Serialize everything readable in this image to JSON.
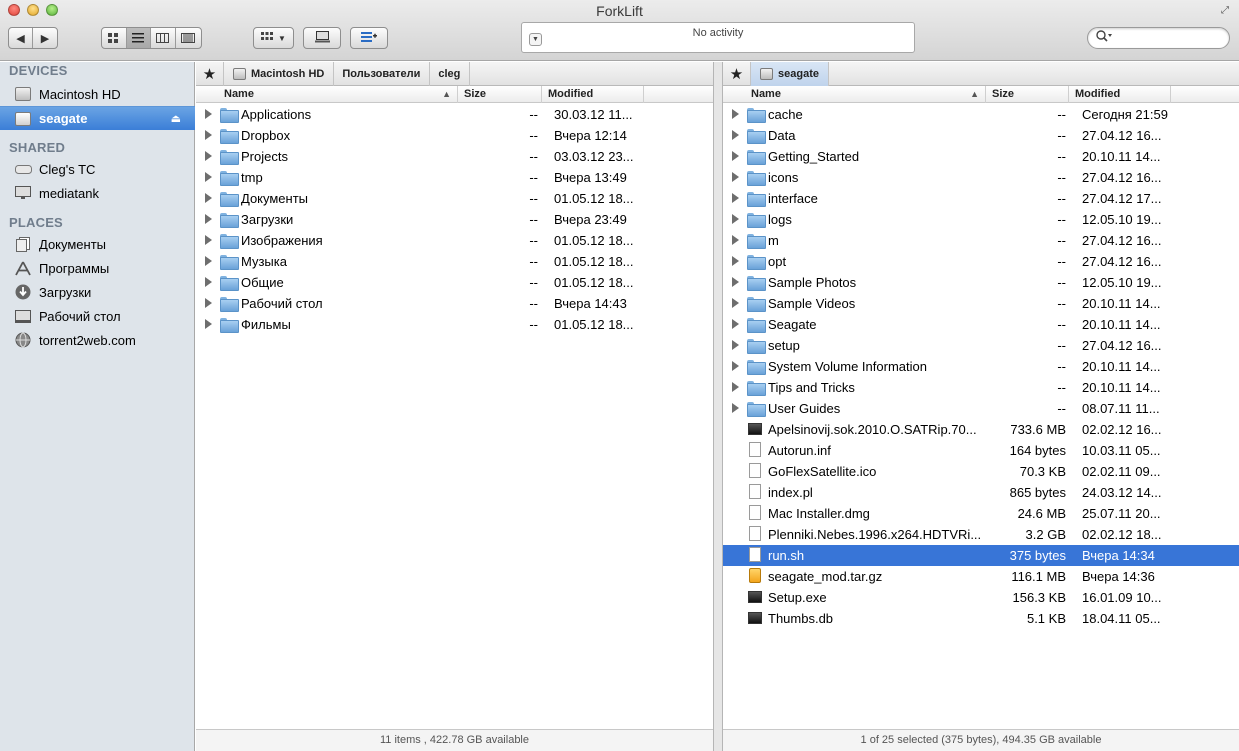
{
  "window": {
    "title": "ForkLift",
    "activity_text": "No activity"
  },
  "sidebar": {
    "sections": [
      {
        "heading": "DEVICES",
        "items": [
          {
            "label": "Macintosh HD",
            "icon": "hard-drive-icon"
          },
          {
            "label": "seagate",
            "icon": "external-drive-icon",
            "selected": true
          }
        ]
      },
      {
        "heading": "SHARED",
        "items": [
          {
            "label": "Cleg's TC",
            "icon": "network-drive-icon"
          },
          {
            "label": "mediatank",
            "icon": "monitor-icon"
          }
        ]
      },
      {
        "heading": "PLACES",
        "items": [
          {
            "label": "Документы",
            "icon": "documents-icon"
          },
          {
            "label": "Программы",
            "icon": "applications-icon"
          },
          {
            "label": "Загрузки",
            "icon": "downloads-icon"
          },
          {
            "label": "Рабочий стол",
            "icon": "desktop-icon"
          },
          {
            "label": "torrent2web.com",
            "icon": "globe-icon"
          }
        ]
      }
    ]
  },
  "left_pane": {
    "path": [
      "Macintosh HD",
      "Пользователи",
      "cleg"
    ],
    "columns": {
      "name": "Name",
      "size": "Size",
      "modified": "Modified"
    },
    "rows": [
      {
        "name": "Applications",
        "size": "--",
        "modified": "30.03.12 11..."
      },
      {
        "name": "Dropbox",
        "size": "--",
        "modified": "Вчера 12:14"
      },
      {
        "name": "Projects",
        "size": "--",
        "modified": "03.03.12 23..."
      },
      {
        "name": "tmp",
        "size": "--",
        "modified": "Вчера 13:49"
      },
      {
        "name": "Документы",
        "size": "--",
        "modified": "01.05.12 18..."
      },
      {
        "name": "Загрузки",
        "size": "--",
        "modified": "Вчера 23:49"
      },
      {
        "name": "Изображения",
        "size": "--",
        "modified": "01.05.12 18..."
      },
      {
        "name": "Музыка",
        "size": "--",
        "modified": "01.05.12 18..."
      },
      {
        "name": "Общие",
        "size": "--",
        "modified": "01.05.12 18..."
      },
      {
        "name": "Рабочий стол",
        "size": "--",
        "modified": "Вчера 14:43"
      },
      {
        "name": "Фильмы",
        "size": "--",
        "modified": "01.05.12 18..."
      }
    ],
    "status": "11 items , 422.78 GB available"
  },
  "right_pane": {
    "path": [
      "seagate"
    ],
    "columns": {
      "name": "Name",
      "size": "Size",
      "modified": "Modified"
    },
    "rows": [
      {
        "name": "cache",
        "size": "--",
        "modified": "Сегодня 21:59",
        "kind": "folder"
      },
      {
        "name": "Data",
        "size": "--",
        "modified": "27.04.12 16...",
        "kind": "folder"
      },
      {
        "name": "Getting_Started",
        "size": "--",
        "modified": "20.10.11 14...",
        "kind": "folder"
      },
      {
        "name": "icons",
        "size": "--",
        "modified": "27.04.12 16...",
        "kind": "folder"
      },
      {
        "name": "interface",
        "size": "--",
        "modified": "27.04.12 17...",
        "kind": "folder"
      },
      {
        "name": "logs",
        "size": "--",
        "modified": "12.05.10 19...",
        "kind": "folder"
      },
      {
        "name": "m",
        "size": "--",
        "modified": "27.04.12 16...",
        "kind": "folder"
      },
      {
        "name": "opt",
        "size": "--",
        "modified": "27.04.12 16...",
        "kind": "folder"
      },
      {
        "name": "Sample Photos",
        "size": "--",
        "modified": "12.05.10 19...",
        "kind": "folder"
      },
      {
        "name": "Sample Videos",
        "size": "--",
        "modified": "20.10.11 14...",
        "kind": "folder"
      },
      {
        "name": "Seagate",
        "size": "--",
        "modified": "20.10.11 14...",
        "kind": "folder"
      },
      {
        "name": "setup",
        "size": "--",
        "modified": "27.04.12 16...",
        "kind": "folder"
      },
      {
        "name": "System Volume Information",
        "size": "--",
        "modified": "20.10.11 14...",
        "kind": "folder"
      },
      {
        "name": "Tips and Tricks",
        "size": "--",
        "modified": "20.10.11 14...",
        "kind": "folder"
      },
      {
        "name": "User Guides",
        "size": "--",
        "modified": "08.07.11 11...",
        "kind": "folder"
      },
      {
        "name": "Apelsinovij.sok.2010.O.SATRip.70...",
        "size": "733.6 MB",
        "modified": "02.02.12 16...",
        "kind": "video"
      },
      {
        "name": "Autorun.inf",
        "size": "164 bytes",
        "modified": "10.03.11 05...",
        "kind": "doc"
      },
      {
        "name": "GoFlexSatellite.ico",
        "size": "70.3 KB",
        "modified": "02.02.11 09...",
        "kind": "doc"
      },
      {
        "name": "index.pl",
        "size": "865 bytes",
        "modified": "24.03.12 14...",
        "kind": "doc"
      },
      {
        "name": "Mac Installer.dmg",
        "size": "24.6 MB",
        "modified": "25.07.11 20...",
        "kind": "doc"
      },
      {
        "name": "Plenniki.Nebes.1996.x264.HDTVRi...",
        "size": "3.2 GB",
        "modified": "02.02.12 18...",
        "kind": "doc"
      },
      {
        "name": "run.sh",
        "size": "375 bytes",
        "modified": "Вчера 14:34",
        "kind": "doc",
        "selected": true
      },
      {
        "name": "seagate_mod.tar.gz",
        "size": "116.1 MB",
        "modified": "Вчера 14:36",
        "kind": "archive"
      },
      {
        "name": "Setup.exe",
        "size": "156.3 KB",
        "modified": "16.01.09 10...",
        "kind": "video"
      },
      {
        "name": "Thumbs.db",
        "size": "5.1 KB",
        "modified": "18.04.11 05...",
        "kind": "video"
      }
    ],
    "status": "1 of 25 selected  (375 bytes), 494.35 GB available"
  },
  "colors": {
    "selection": "#3875d7",
    "sidebar_bg": "#dee4ea",
    "sidebar_heading": "#707d8c"
  }
}
